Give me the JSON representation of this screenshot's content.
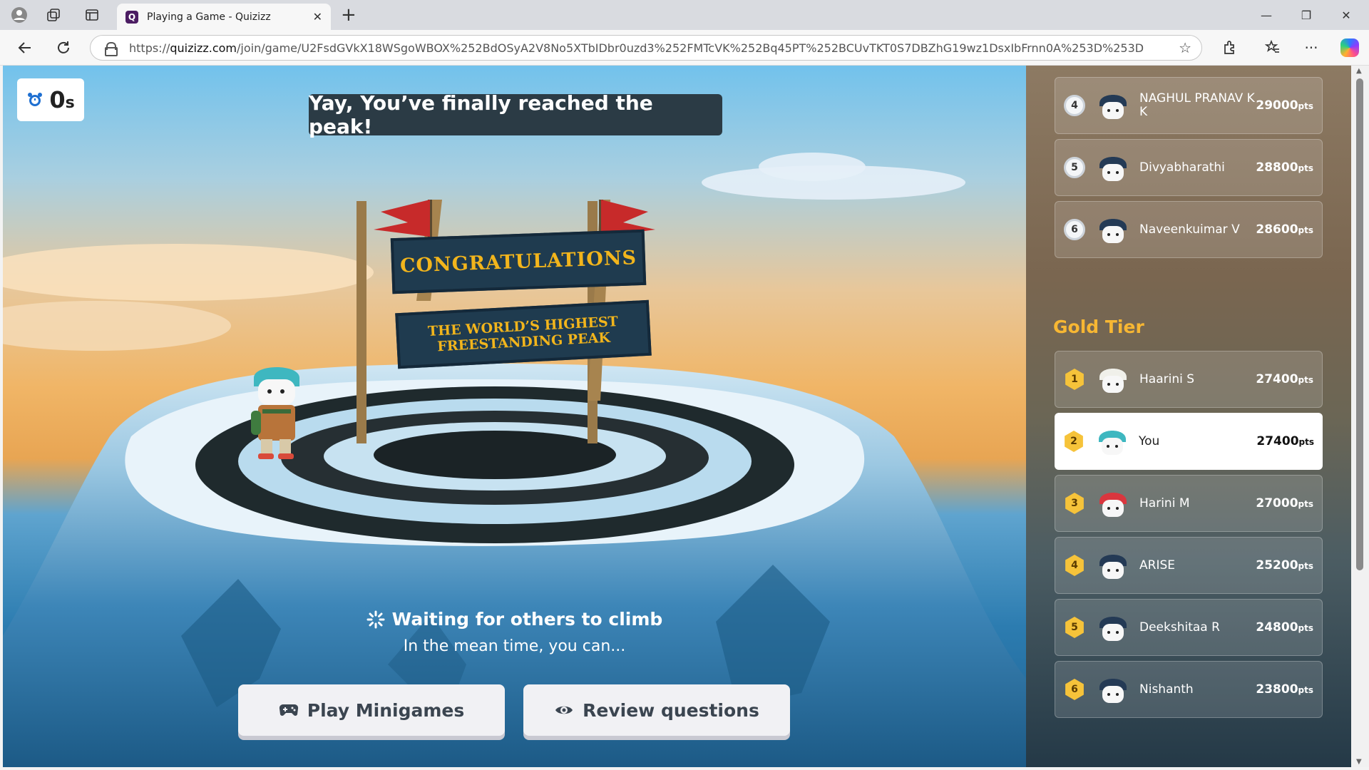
{
  "browser": {
    "tab_title": "Playing a Game - Quizizz",
    "tab_favicon_letter": "Q",
    "url_prefix": "https://",
    "url_domain": "quizizz.com",
    "url_path": "/join/game/U2FsdGVkX18WSgoWBOX%252BdOSyA2V8No5XTbIDbr0uzd3%252FMTcVK%252Bq45PT%252BCUvTKT0S7DBZhG19wz1DsxIbFrnn0A%253D%253D",
    "icons": [
      "profile-icon",
      "workspaces-icon",
      "tab-actions-icon",
      "back-icon",
      "refresh-icon",
      "lock-icon",
      "favorite-star-icon",
      "extensions-icon",
      "favorites-icon",
      "more-icon",
      "copilot-icon",
      "minimize-icon",
      "restore-icon",
      "close-icon"
    ]
  },
  "game": {
    "timer_value": "0",
    "timer_unit": "s",
    "banner": "Yay, You’ve finally reached the peak!",
    "sign_top": "CONGRATULATIONS",
    "sign_bottom_line1": "THE WORLD’S HIGHEST",
    "sign_bottom_line2": "FREESTANDING PEAK",
    "waiting_title": "Waiting for others to climb",
    "waiting_sub": "In the mean time, you can...",
    "btn_minigames": "Play Minigames",
    "btn_review": "Review questions",
    "colors": {
      "banner_bg": "#2b3b45",
      "sign_bg": "#1f3b4f",
      "sign_text": "#f2b51c"
    }
  },
  "leaderboard": {
    "top_rows": [
      {
        "rank": "4",
        "name": "NAGHUL PRANAV K K",
        "points": "29000",
        "unit": "pts"
      },
      {
        "rank": "5",
        "name": "Divyabharathi",
        "points": "28800",
        "unit": "pts"
      },
      {
        "rank": "6",
        "name": "Naveenkuimar V",
        "points": "28600",
        "unit": "pts"
      }
    ],
    "tier_title": "Gold Tier",
    "tier_rows": [
      {
        "rank": "1",
        "name": "Haarini S",
        "points": "27400",
        "unit": "pts"
      },
      {
        "rank": "2",
        "name": "You",
        "points": "27400",
        "unit": "pts"
      },
      {
        "rank": "3",
        "name": "Harini M",
        "points": "27000",
        "unit": "pts"
      },
      {
        "rank": "4",
        "name": "ARISE",
        "points": "25200",
        "unit": "pts"
      },
      {
        "rank": "5",
        "name": "Deekshitaa R",
        "points": "24800",
        "unit": "pts"
      },
      {
        "rank": "6",
        "name": "Nishanth",
        "points": "23800",
        "unit": "pts"
      }
    ],
    "colors": {
      "tier_title": "#f7b733",
      "rank_gold": "#f6c33a",
      "rank_silver": "#cdd3da"
    }
  }
}
